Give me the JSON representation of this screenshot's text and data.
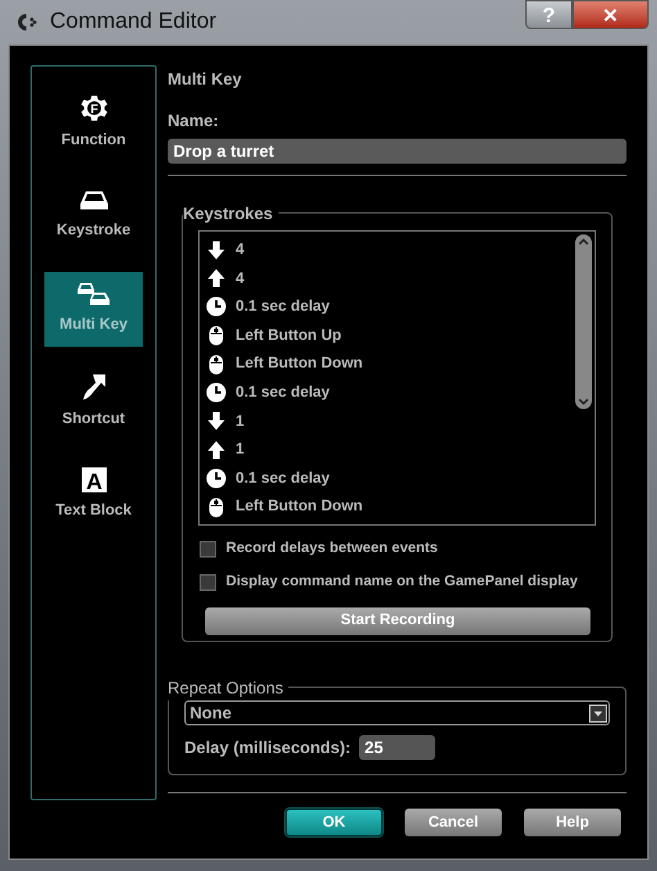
{
  "window": {
    "title": "Command Editor",
    "buttons": [
      "?",
      "✕"
    ]
  },
  "sidebar": {
    "items": [
      {
        "kind": "function",
        "glyph": "F",
        "label": "Function",
        "selected": false
      },
      {
        "kind": "keystroke",
        "label": "Keystroke",
        "selected": false
      },
      {
        "kind": "multikey",
        "label": "Multi Key",
        "selected": true
      },
      {
        "kind": "shortcut",
        "label": "Shortcut",
        "selected": false
      },
      {
        "kind": "textblock",
        "glyph": "A",
        "label": "Text Block",
        "selected": false
      }
    ]
  },
  "heading": "Multi Key",
  "name": {
    "label": "Name:",
    "value": "Drop a turret"
  },
  "keystrokes": {
    "title": "Keystrokes",
    "items": [
      {
        "kind": "down",
        "label": "4"
      },
      {
        "kind": "up",
        "label": "4"
      },
      {
        "kind": "delay",
        "label": "0.1 sec delay"
      },
      {
        "kind": "mouse",
        "label": "Left Button Up"
      },
      {
        "kind": "mouse",
        "label": "Left Button Down"
      },
      {
        "kind": "delay",
        "label": "0.1 sec delay"
      },
      {
        "kind": "down",
        "label": "1"
      },
      {
        "kind": "up",
        "label": "1"
      },
      {
        "kind": "delay",
        "label": "0.1 sec delay"
      },
      {
        "kind": "mouse",
        "label": "Left Button Down"
      }
    ],
    "options": [
      {
        "label": "Record delays between events",
        "checked": false
      },
      {
        "label": "Display command name on the GamePanel display",
        "checked": false
      }
    ],
    "record_button": "Start Recording"
  },
  "repeat": {
    "title": "Repeat Options",
    "mode": "None",
    "delay_label": "Delay (milliseconds):",
    "delay_value": "25"
  },
  "buttons": [
    {
      "label": "OK",
      "primary": true
    },
    {
      "label": "Cancel",
      "primary": false
    },
    {
      "label": "Help",
      "primary": false
    }
  ]
}
